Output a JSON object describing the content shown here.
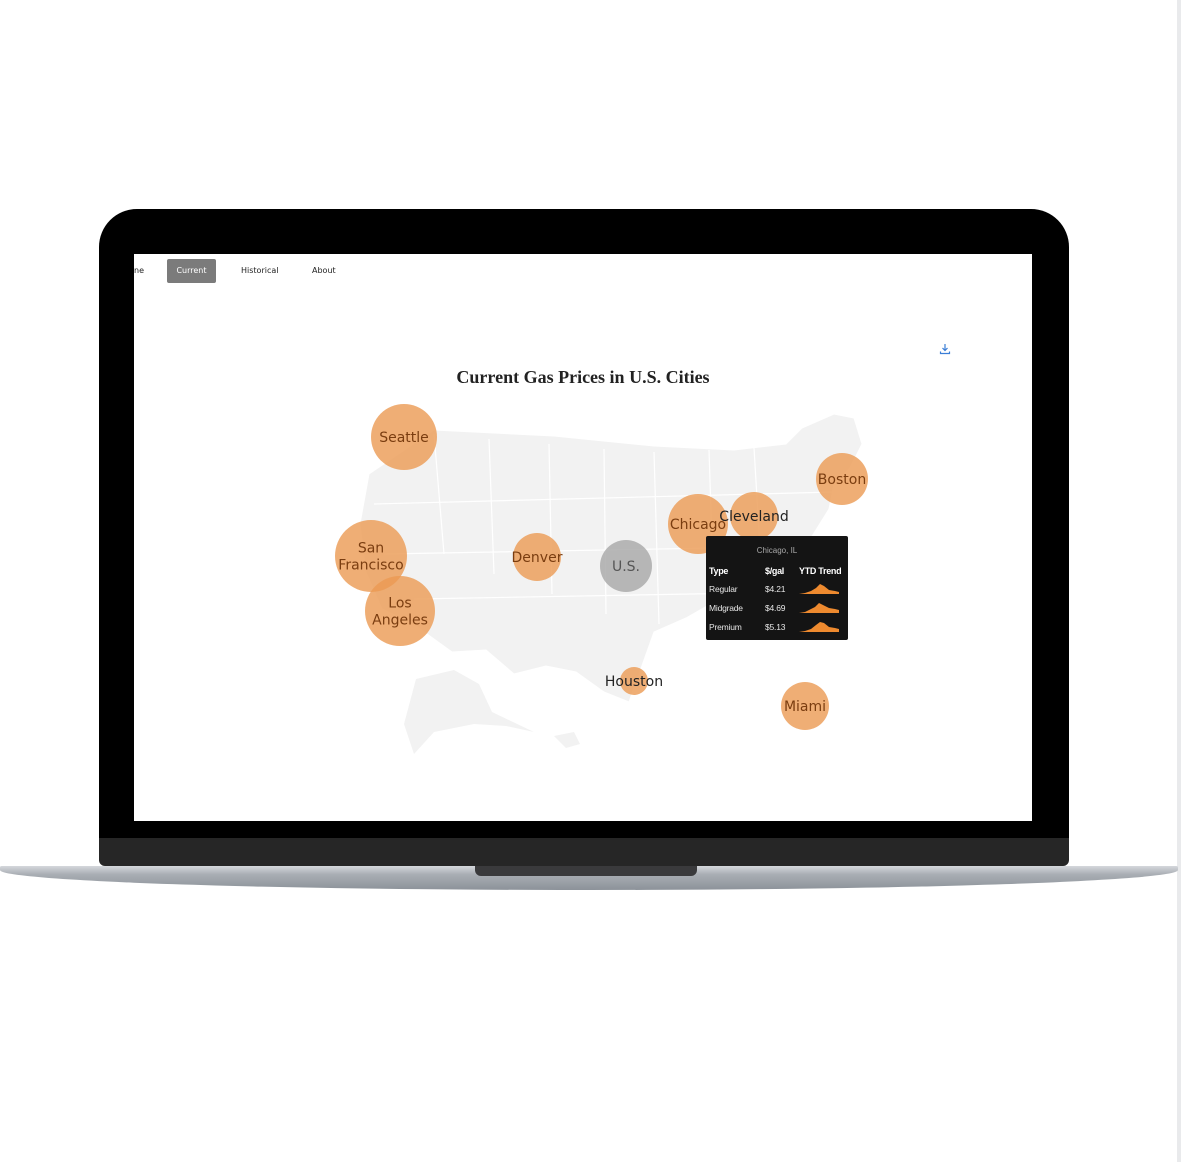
{
  "nav": {
    "items": [
      {
        "label": "ne"
      },
      {
        "label": "Current"
      },
      {
        "label": "Historical"
      },
      {
        "label": "About"
      }
    ]
  },
  "chart": {
    "title": "Current Gas Prices in U.S. Cities"
  },
  "chart_data": {
    "type": "bubble-map",
    "title": "Current Gas Prices in U.S. Cities",
    "cities": [
      {
        "name": "Seattle"
      },
      {
        "name": "San Francisco"
      },
      {
        "name": "Los Angeles"
      },
      {
        "name": "Denver"
      },
      {
        "name": "U.S."
      },
      {
        "name": "Chicago"
      },
      {
        "name": "Cleveland"
      },
      {
        "name": "Boston"
      },
      {
        "name": "Houston"
      },
      {
        "name": "Miami"
      }
    ],
    "tooltip": {
      "city": "Chicago, IL",
      "columns": [
        "Type",
        "$/gal",
        "YTD Trend"
      ],
      "rows": [
        {
          "type": "Regular",
          "price": "$4.21",
          "price_value": 4.21
        },
        {
          "type": "Midgrade",
          "price": "$4.69",
          "price_value": 4.69
        },
        {
          "type": "Premium",
          "price": "$5.13",
          "price_value": 5.13
        }
      ]
    }
  },
  "colors": {
    "bubble": "#eb9a52",
    "bubble_text": "#7a3d10",
    "us_bubble": "#a6a6a6",
    "map": "#f3f3f3",
    "tooltip_bg": "#141414",
    "spark": "#ee8a2f"
  }
}
